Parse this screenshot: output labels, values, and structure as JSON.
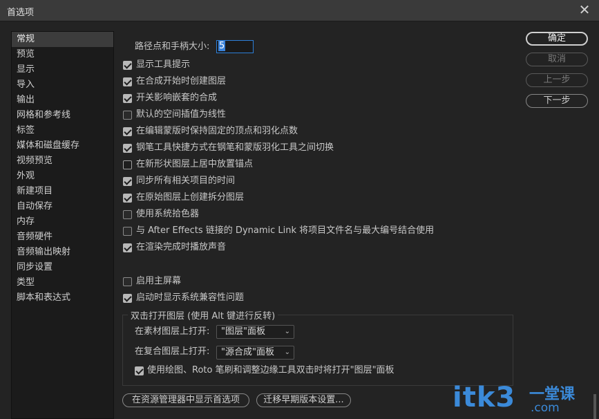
{
  "window": {
    "title": "首选项"
  },
  "icons": {
    "close": "close-icon",
    "check": "check-icon",
    "dropdown": "chevron-down-icon"
  },
  "sidebar": {
    "items": [
      {
        "label": "常规",
        "active": true
      },
      {
        "label": "预览"
      },
      {
        "label": "显示"
      },
      {
        "label": "导入"
      },
      {
        "label": "输出"
      },
      {
        "label": "网格和参考线"
      },
      {
        "label": "标签"
      },
      {
        "label": "媒体和磁盘缓存"
      },
      {
        "label": "视频预览"
      },
      {
        "label": "外观"
      },
      {
        "label": "新建项目"
      },
      {
        "label": "自动保存"
      },
      {
        "label": "内存"
      },
      {
        "label": "音频硬件"
      },
      {
        "label": "音频输出映射"
      },
      {
        "label": "同步设置"
      },
      {
        "label": "类型"
      },
      {
        "label": "脚本和表达式"
      }
    ]
  },
  "general": {
    "path_point_label": "路径点和手柄大小:",
    "path_point_value": "5",
    "options": [
      {
        "label": "显示工具提示",
        "checked": true
      },
      {
        "label": "在合成开始时创建图层",
        "checked": true
      },
      {
        "label": "开关影响嵌套的合成",
        "checked": true
      },
      {
        "label": "默认的空间插值为线性",
        "checked": false
      },
      {
        "label": "在编辑蒙版时保持固定的顶点和羽化点数",
        "checked": true
      },
      {
        "label": "钢笔工具快捷方式在钢笔和蒙版羽化工具之间切换",
        "checked": true
      },
      {
        "label": "在新形状图层上居中放置锚点",
        "checked": false
      },
      {
        "label": "同步所有相关项目的时间",
        "checked": true
      },
      {
        "label": "在原始图层上创建拆分图层",
        "checked": true
      },
      {
        "label": "使用系统拾色器",
        "checked": false
      },
      {
        "label": "与 After Effects 链接的 Dynamic Link 将项目文件名与最大编号结合使用",
        "checked": false
      },
      {
        "label": "在渲染完成时播放声音",
        "checked": true
      }
    ],
    "home_screen": {
      "label": "启用主屏幕",
      "checked": false
    },
    "compat": {
      "label": "启动时显示系统兼容性问题",
      "checked": true
    }
  },
  "double_click": {
    "legend": "双击打开图层 (使用 Alt 键进行反转)",
    "footage_label": "在素材图层上打开:",
    "footage_value": "\"图层\"面板",
    "comp_label": "在复合图层上打开:",
    "comp_value": "\"源合成\"面板",
    "paint": {
      "label": "使用绘图、Roto 笔刷和调整边缘工具双击时将打开\"图层\"面板",
      "checked": true
    }
  },
  "buttons": {
    "ok": "确定",
    "cancel": "取消",
    "prev": "上一步",
    "next": "下一步",
    "reveal": "在资源管理器中显示首选项",
    "migrate": "迁移早期版本设置..."
  },
  "watermark": {
    "main": "itk3",
    "sub1": "一堂课",
    "sub2": ".com"
  }
}
